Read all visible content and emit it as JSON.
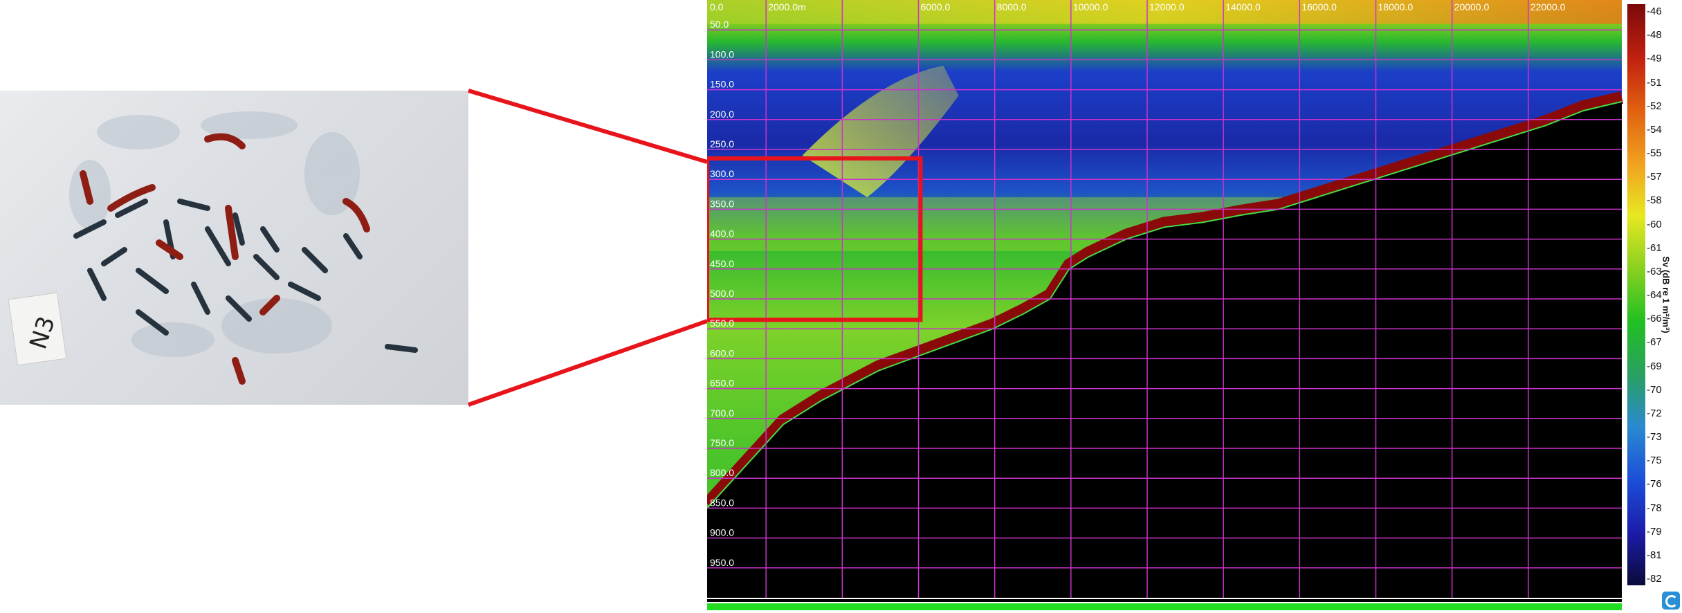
{
  "photo": {
    "label_text": "N3"
  },
  "colors": {
    "connector": "#e8141c",
    "grid": "#cc33cc",
    "seabed": "#000000",
    "depth_label": "#ffffff",
    "distance_label": "#ffffff",
    "bottom_bar": "#22dd22"
  },
  "chart_data": {
    "type": "heatmap",
    "title": "",
    "x": {
      "unit": "m",
      "range": [
        0,
        24000
      ],
      "tick_labels": [
        "0.0",
        "2000.0m",
        "6000.0",
        "8000.0",
        "10000.0",
        "12000.0",
        "14000.0",
        "16000.0",
        "18000.0",
        "20000.0",
        "22000.0"
      ],
      "tick_values": [
        0,
        2000,
        6000,
        8000,
        10000,
        12000,
        14000,
        16000,
        18000,
        20000,
        22000
      ]
    },
    "y": {
      "unit": "m",
      "range": [
        0,
        1000
      ],
      "inverted": true,
      "tick_labels": [
        "50.0",
        "100.0",
        "150.0",
        "200.0",
        "250.0",
        "300.0",
        "350.0",
        "400.0",
        "450.0",
        "500.0",
        "550.0",
        "600.0",
        "650.0",
        "700.0",
        "750.0",
        "800.0",
        "850.0",
        "900.0",
        "950.0"
      ],
      "tick_values": [
        50,
        100,
        150,
        200,
        250,
        300,
        350,
        400,
        450,
        500,
        550,
        600,
        650,
        700,
        750,
        800,
        850,
        900,
        950
      ]
    },
    "grid": true,
    "seabed_depth_profile": {
      "x": [
        0,
        1000,
        2000,
        3000,
        4500,
        6000,
        7500,
        8300,
        9000,
        9500,
        10000,
        11000,
        12000,
        13000,
        14000,
        15000,
        16000,
        17000,
        18000,
        19000,
        20000,
        21000,
        22000,
        23000,
        24000
      ],
      "depth": [
        850,
        780,
        710,
        670,
        620,
        585,
        550,
        525,
        500,
        450,
        430,
        400,
        380,
        372,
        360,
        350,
        330,
        310,
        290,
        270,
        250,
        230,
        210,
        185,
        170
      ]
    },
    "highlight_box": {
      "x_range": [
        0,
        5600
      ],
      "depth_range": [
        265,
        535
      ]
    },
    "colorbar": {
      "label": "Sv (dB re 1 m²/m³)",
      "ticks": [
        -46,
        -48,
        -49,
        -51,
        -52,
        -54,
        -55,
        -57,
        -58,
        -60,
        -61,
        -63,
        -64,
        -66,
        -67,
        -69,
        -70,
        -72,
        -73,
        -75,
        -76,
        -78,
        -79,
        -81,
        -82
      ],
      "range": [
        -82,
        -46
      ],
      "colors": [
        "#0a0a3a",
        "#1c1caa",
        "#1c4fd8",
        "#2a8ad0",
        "#2aa060",
        "#22c022",
        "#8ad020",
        "#e8e820",
        "#f0a020",
        "#e06010",
        "#c02010",
        "#7a0a0a"
      ]
    }
  }
}
